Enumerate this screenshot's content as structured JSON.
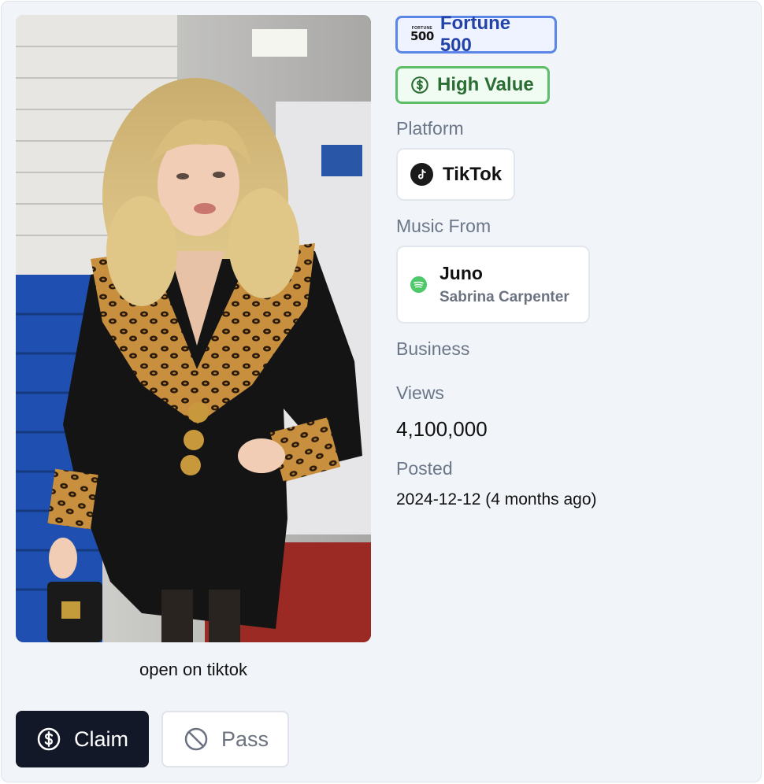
{
  "media": {
    "open_link_label": "open on tiktok"
  },
  "actions": {
    "claim_label": "Claim",
    "pass_label": "Pass"
  },
  "badges": {
    "fortune_logo_top": "FORTUNE",
    "fortune_logo_number": "500",
    "fortune_label": "Fortune 500",
    "value_label": "High Value"
  },
  "details": {
    "platform_label": "Platform",
    "platform_name": "TikTok",
    "music_label": "Music From",
    "music_title": "Juno",
    "music_artist": "Sabrina Carpenter",
    "business_label": "Business",
    "views_label": "Views",
    "views_value": "4,100,000",
    "posted_label": "Posted",
    "posted_value": "2024-12-12 (4 months ago)"
  },
  "colors": {
    "claim_bg": "#121827",
    "fortune_border": "#5b86e8",
    "value_border": "#5dbd69",
    "spotify_green": "#4fc86a",
    "label_gray": "#6b7688"
  },
  "icons": {
    "claim": "dollar-circle-icon",
    "pass": "ban-icon",
    "value": "dollar-circle-icon",
    "platform": "tiktok-icon",
    "music": "spotify-icon"
  }
}
